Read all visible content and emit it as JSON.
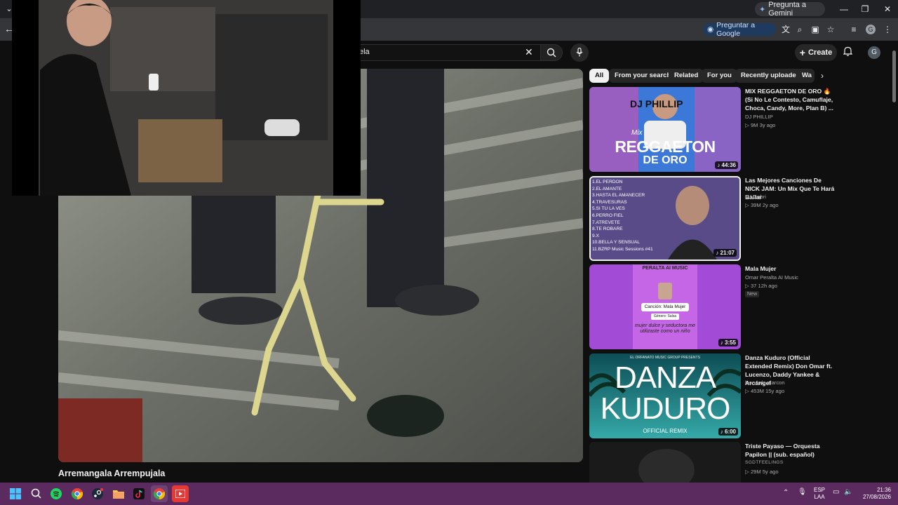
{
  "browser": {
    "gemini_label": "Pregunta a Gemini",
    "google_ask_label": "Preguntar a Google",
    "profile_letter": "G"
  },
  "header": {
    "search_value": "ela",
    "create_label": "Create",
    "avatar_letter": "G"
  },
  "video": {
    "title": "Arremangala Arrempujala"
  },
  "chips": [
    "All",
    "From your search",
    "Related",
    "For you",
    "Recently uploaded",
    "Wa"
  ],
  "recommendations": [
    {
      "title": "MIX REGGAETON DE ORO 🔥 (Si No Le Contesto, Camuflaje, Choca, Candy, More, Plan B) ...",
      "channel": "DJ PHILLIP",
      "meta": "▷ 9M  3y ago",
      "duration": "♪ 44:36",
      "thumb_text_1": "DJ PHILLIP",
      "thumb_text_2": "Mix",
      "thumb_text_3": "REGGAETON",
      "thumb_text_4": "DE ORO"
    },
    {
      "title": "Las Mejores Canciones De NICK JAM: Un Mix Que Te Hará Bailar",
      "channel": "DJ Gabri",
      "meta": "▷ 39M  2y ago",
      "duration": "♪ 21:07",
      "tracklist": [
        "1.EL PERDON",
        "2.EL AMANTE",
        "3.HASTA EL AMANECER",
        "4.TRAVESURAS",
        "5.SI TU LA VES",
        "6.PERRO FIEL",
        "7.ATREVETE",
        "8.TE ROBARE",
        "9.X",
        "10.BELLA Y SENSUAL",
        "11.BZRP Music Sessions #41"
      ]
    },
    {
      "title": "Mala Mujer",
      "channel": "Omar Peralta AI Music",
      "meta": "▷ 37  12h ago",
      "badge": "New",
      "duration": "♪ 3:55",
      "thumb_logo": "PERALTA AI MUSIC",
      "thumb_song": "Canción: Mala Mujer",
      "thumb_genre": "Género: Salsa",
      "thumb_lyric": "mujer dulce y seductora me utilizaste como un niño"
    },
    {
      "title": "Danza Kuduro (Official Extended Remix) Don Omar ft. Lucenzo, Daddy Yankee & Arcángel",
      "channel": "leonardo alarcon",
      "meta": "▷ 453M  15y ago",
      "duration": "♪ 6:00",
      "thumb_top": "EL ORFANATO MUSIC GROUP PRESENTS",
      "thumb_line1": "DANZA",
      "thumb_line2": "KUDURO",
      "thumb_sub": "OFFICIAL REMIX"
    },
    {
      "title": "Triste Payaso — Orquesta Papilon || (sub. español)",
      "channel": "SGDTFEELINGS",
      "meta": "▷ 29M  5y ago"
    }
  ],
  "taskbar": {
    "lang_1": "ESP",
    "lang_2": "LAA",
    "time": "21:36",
    "date": "27/08/2026"
  }
}
